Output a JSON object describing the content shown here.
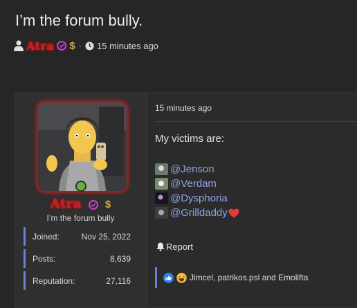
{
  "thread": {
    "title": "I’m the forum bully.",
    "author": "Atra",
    "separator": "·",
    "time": "15 minutes ago"
  },
  "user": {
    "name": "Atra",
    "title": "I’m the forum bully",
    "dollar": "$",
    "stats": [
      {
        "label": "Joined:",
        "value": "Nov 25, 2022"
      },
      {
        "label": "Posts:",
        "value": "8,639"
      },
      {
        "label": "Reputation:",
        "value": "27,116"
      }
    ]
  },
  "post": {
    "time": "15 minutes ago",
    "body": "My victims are:",
    "mentions": [
      "@Jenson",
      "@Verdam",
      "@Dysphoria",
      "@Grilldaddy"
    ],
    "report_label": "Report",
    "reactions_text": "Jimcel, patrikos.psl and Emolifta"
  },
  "icons": {
    "user": "user-icon",
    "verified": "verified-badge-icon",
    "clock": "clock-icon",
    "bell": "bell-icon",
    "like": "like-reaction-icon",
    "laugh": "laugh-reaction-icon",
    "heart": "heart-icon"
  },
  "colors": {
    "author_name": "#cc1e1e",
    "link": "#8ea3e6",
    "accent_bar": "#6c7fd0",
    "online": "#62b53a",
    "verified": "#d63ad6"
  }
}
